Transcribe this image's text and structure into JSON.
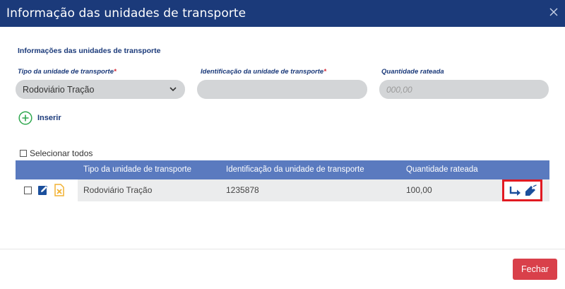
{
  "header": {
    "title": "Informação das unidades de transporte",
    "close_icon": "close-icon"
  },
  "form": {
    "section_title": "Informações das unidades de transporte",
    "tipo_label": "Tipo da unidade de transporte",
    "tipo_required": "*",
    "tipo_value": "Rodoviário Tração",
    "ident_label": "Identificação da unidade de transporte",
    "ident_required": "*",
    "ident_value": "",
    "qty_label": "Quantidade rateada",
    "qty_placeholder": "000,00"
  },
  "insert": {
    "label": "Inserir",
    "icon": "plus-circle-icon"
  },
  "select_all": {
    "label": "Selecionar todos"
  },
  "table": {
    "columns": [
      "Tipo da unidade de transporte",
      "Identificação da unidade de transporte",
      "Quantidade rateada"
    ],
    "rows": [
      {
        "tipo": "Rodoviário Tração",
        "ident": "1235878",
        "qty": "100,00"
      }
    ]
  },
  "footer": {
    "close_label": "Fechar"
  },
  "colors": {
    "header": "#1b3a7a",
    "table_header": "#5a7abf",
    "highlight_border": "#e11a22",
    "close_button": "#d9404a",
    "insert_green": "#2fa84f"
  }
}
